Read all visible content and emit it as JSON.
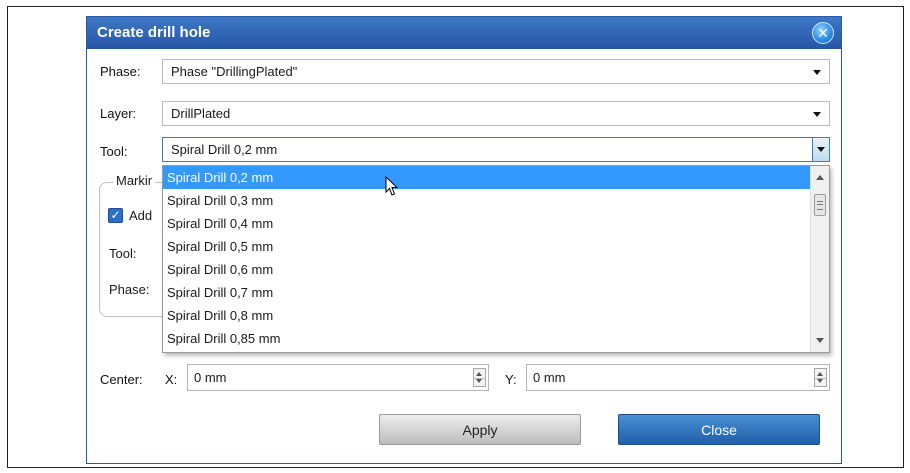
{
  "dialog": {
    "title": "Create drill hole",
    "close_icon": "close-icon",
    "colors": {
      "titlebar": "#2f66b3",
      "selection": "#3399ff",
      "close_button": "#2563ab"
    }
  },
  "phase": {
    "label": "Phase:",
    "value": "Phase \"DrillingPlated\""
  },
  "layer": {
    "label": "Layer:",
    "value": "DrillPlated"
  },
  "tool": {
    "label": "Tool:",
    "value": "Spiral Drill  0,2 mm",
    "options": [
      "Spiral Drill  0,2 mm",
      "Spiral Drill  0,3 mm",
      "Spiral Drill  0,4 mm",
      "Spiral Drill  0,5 mm",
      "Spiral Drill  0,6 mm",
      "Spiral Drill  0,7 mm",
      "Spiral Drill  0,8 mm",
      "Spiral Drill  0,85 mm"
    ]
  },
  "marking": {
    "title": "Markir",
    "add_label": "Add",
    "add_checked": true,
    "tool_label": "Tool:",
    "phase_label": "Phase:"
  },
  "center": {
    "label": "Center:",
    "x_label": "X:",
    "x_value": "0 mm",
    "y_label": "Y:",
    "y_value": "0 mm"
  },
  "buttons": {
    "apply": "Apply",
    "close": "Close"
  }
}
